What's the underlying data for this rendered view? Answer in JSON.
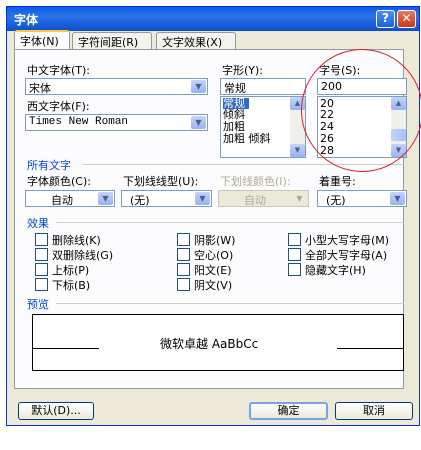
{
  "window": {
    "title": "字体",
    "help_label": "?",
    "close_label": "✕"
  },
  "tabs": [
    {
      "label": "字体(N)"
    },
    {
      "label": "字符间距(R)"
    },
    {
      "label": "文字效果(X)"
    }
  ],
  "font": {
    "chinese_font_label": "中文字体(T):",
    "chinese_font_value": "宋体",
    "western_font_label": "西文字体(F):",
    "western_font_value": "Times New Roman",
    "style_label": "字形(Y):",
    "style_value": "常规",
    "style_options": [
      "常规",
      "倾斜",
      "加粗",
      "加粗 倾斜"
    ],
    "size_label": "字号(S):",
    "size_value": "200",
    "size_options": [
      "20",
      "22",
      "24",
      "26",
      "28"
    ]
  },
  "all_text": {
    "section_label": "所有文字",
    "color_label": "字体颜色(C):",
    "color_value": "自动",
    "underline_label": "下划线线型(U):",
    "underline_value": "(无)",
    "underline_color_label": "下划线颜色(I):",
    "underline_color_value": "自动",
    "emphasis_label": "着重号:",
    "emphasis_value": "(无)"
  },
  "effects": {
    "section_label": "效果",
    "items": [
      {
        "label": "删除线(K)"
      },
      {
        "label": "双删除线(G)"
      },
      {
        "label": "上标(P)"
      },
      {
        "label": "下标(B)"
      },
      {
        "label": "阴影(W)"
      },
      {
        "label": "空心(O)"
      },
      {
        "label": "阳文(E)"
      },
      {
        "label": "阴文(V)"
      },
      {
        "label": "小型大写字母(M)"
      },
      {
        "label": "全部大写字母(A)"
      },
      {
        "label": "隐藏文字(H)"
      }
    ]
  },
  "preview": {
    "section_label": "预览",
    "sample_text": "微软卓越 AaBbCc"
  },
  "buttons": {
    "default_label": "默认(D)...",
    "ok_label": "确定",
    "cancel_label": "取消"
  },
  "colors": {
    "title_bar": "#0a5ee8",
    "dialog_bg": "#ece9d8",
    "selection": "#316ac5",
    "annotation": "#d9212a"
  }
}
